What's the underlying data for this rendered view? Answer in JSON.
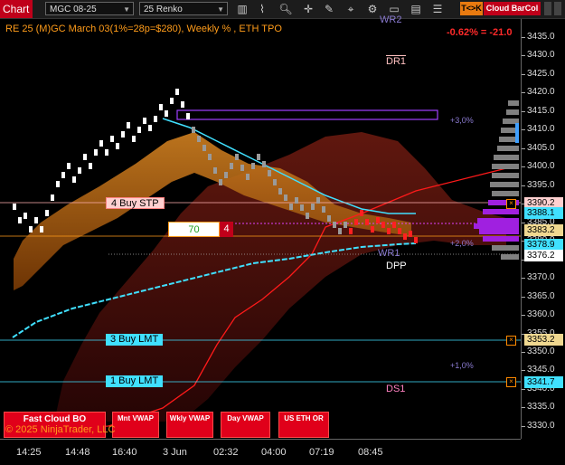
{
  "toolbar": {
    "app_label": "Chart",
    "instrument": "MGC 08-25",
    "bar_type": "25 Renko",
    "tok_label": "T<>K",
    "cloud_label": "Cloud BarCol"
  },
  "header": {
    "title": "RE 25 (M)GC March 03(1%=28p=$280), Weekly % , ETH TPO",
    "change": "-0.62% = -21.0"
  },
  "y_axis": {
    "ticks": [
      "3435.0",
      "3430.0",
      "3425.0",
      "3420.0",
      "3415.0",
      "3410.0",
      "3405.0",
      "3400.0",
      "3395.0",
      "3390.0",
      "3385.0",
      "3380.0",
      "3375.0",
      "3370.0",
      "3365.0",
      "3360.0",
      "3355.0",
      "3350.0",
      "3345.0",
      "3340.0",
      "3335.0",
      "3330.0"
    ],
    "price_labels": [
      {
        "text": "3390.2",
        "bg": "#ffd0d0"
      },
      {
        "text": "3388.1",
        "bg": "#40e0ff"
      },
      {
        "text": "3383.2",
        "bg": "#f0d890"
      },
      {
        "text": "3378.9",
        "bg": "#40e0ff"
      },
      {
        "text": "3376.2",
        "bg": "#ffffff"
      },
      {
        "text": "3353.2",
        "bg": "#f0d890"
      },
      {
        "text": "3341.7",
        "bg": "#40e0ff"
      }
    ]
  },
  "x_axis": {
    "ticks": [
      "14:25",
      "14:48",
      "16:40",
      "3 Jun",
      "02:32",
      "04:00",
      "07:19",
      "08:45"
    ]
  },
  "orders": [
    {
      "label": "4 Buy STP",
      "bg": "#ffd0d0"
    },
    {
      "label": "3 Buy LMT",
      "bg": "#40e0ff"
    },
    {
      "label": "1 Buy LMT",
      "bg": "#40e0ff"
    }
  ],
  "position_box": {
    "qty": "70",
    "count": "4"
  },
  "levels": {
    "wr2": "WR2",
    "dr1": "DR1",
    "pct3": "+3,0%",
    "pct2": "+2,0%",
    "pct1": "+1,0%",
    "wr1": "WR1",
    "dpp": "DPP",
    "ds1": "DS1"
  },
  "bottom_buttons": [
    {
      "label": "Fast Cloud BO"
    },
    {
      "label": "Mnt VWAP"
    },
    {
      "label": "Wkly VWAP"
    },
    {
      "label": "Day VWAP"
    },
    {
      "label": "US ETH OR"
    }
  ],
  "copyright": "© 2025 NinjaTrader, LLC",
  "colors": {
    "cloud_orange": "#c46a10",
    "cloud_red": "#5a1010",
    "vwap": "#40e0ff",
    "stop_line": "#ff1a1a"
  }
}
